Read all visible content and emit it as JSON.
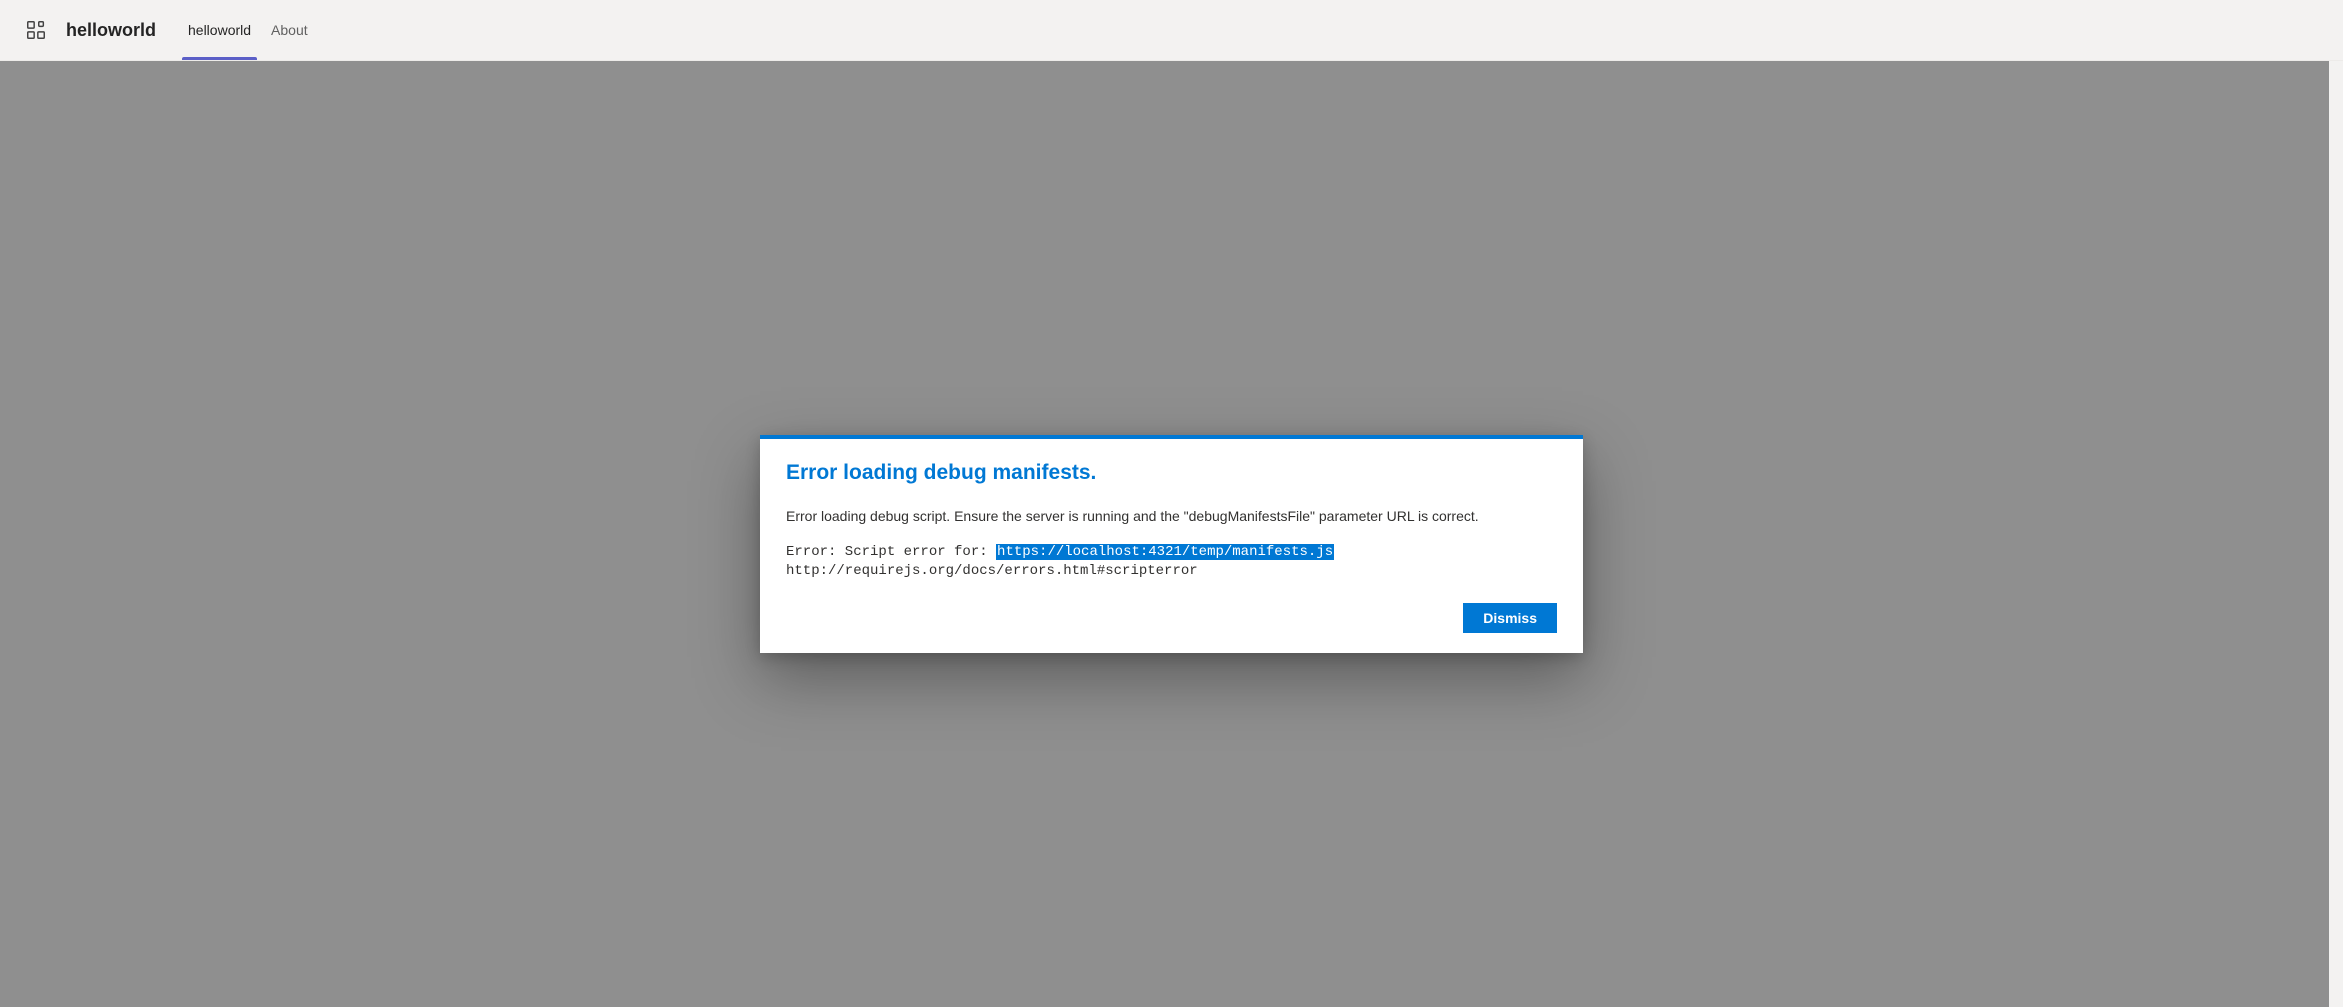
{
  "header": {
    "app_title": "helloworld",
    "tabs": [
      {
        "label": "helloworld",
        "active": true
      },
      {
        "label": "About",
        "active": false
      }
    ]
  },
  "dialog": {
    "title": "Error loading debug manifests.",
    "description": "Error loading debug script. Ensure the server is running and the \"debugManifestsFile\" parameter URL is correct.",
    "error_prefix": "Error: Script error for: ",
    "error_url_highlighted": "https://localhost:4321/temp/manifests.js",
    "error_line2": "http://requirejs.org/docs/errors.html#scripterror",
    "dismiss_label": "Dismiss"
  },
  "colors": {
    "accent": "#0078d4",
    "tab_indicator": "#5b5fc7",
    "header_bg": "#f3f2f1",
    "main_bg": "#8f8f8f"
  }
}
